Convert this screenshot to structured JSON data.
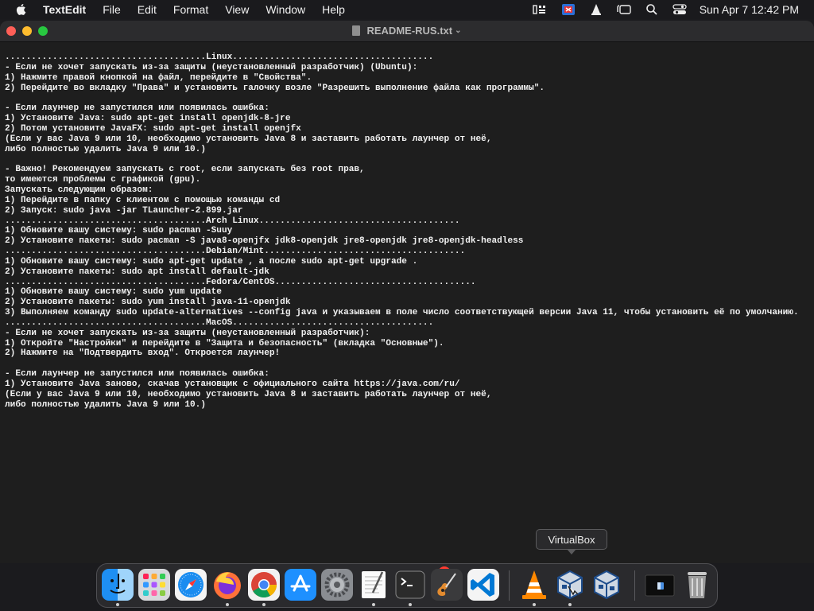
{
  "menubar": {
    "app_name": "TextEdit",
    "items": [
      "File",
      "Edit",
      "Format",
      "View",
      "Window",
      "Help"
    ],
    "clock": "Sun Apr 7  12:42 PM",
    "status_icons": [
      "keyboard-viewer-icon",
      "screen-share-icon",
      "vlc-icon",
      "window-icon",
      "search-icon",
      "control-center-icon"
    ]
  },
  "window": {
    "title": "README-RUS.txt",
    "lines": [
      "......................................Linux......................................",
      "- Если не хочет запускать из-за защиты (неустановленный разработчик) (Ubuntu):",
      "1) Нажмите правой кнопкой на файл, перейдите в \"Свойства\".",
      "2) Перейдите во вкладку \"Права\" и установить галочку возле \"Разрешить выполнение файла как программы\".",
      "",
      "- Если лаунчер не запустился или появилась ошибка:",
      "1) Установите Java: sudo apt-get install openjdk-8-jre",
      "2) Потом установите JavaFX: sudo apt-get install openjfx",
      "(Если у вас Java 9 или 10, необходимо установить Java 8 и заставить работать лаунчер от неё,",
      "либо полностью удалить Java 9 или 10.)",
      "",
      "- Важно! Рекомендуем запускать с root, если запускать без root прав,",
      "то имеются проблемы с графикой (gpu).",
      "Запускать следующим образом:",
      "1) Перейдите в папку с клиентом с помощью команды cd",
      "2) Запуск: sudo java -jar TLauncher-2.899.jar",
      "......................................Arch Linux......................................",
      "1) Обновите вашу систему: sudo pacman -Suuy",
      "2) Установите пакеты: sudo pacman -S java8-openjfx jdk8-openjdk jre8-openjdk jre8-openjdk-headless",
      "......................................Debian/Mint......................................",
      "1) Обновите вашу систему: sudo apt-get update , а после sudo apt-get upgrade .",
      "2) Установите пакеты: sudo apt install default-jdk",
      "......................................Fedora/CentOS......................................",
      "1) Обновите вашу систему: sudo yum update",
      "2) Установите пакеты: sudo yum install java-11-openjdk",
      "3) Выполняем команду sudo update-alternatives --config java и указываем в поле число соответствующей версии Java 11, чтобы установить её по умолчанию.",
      "......................................MacOS......................................",
      "- Если не хочет запускать из-за защиты (неустановленный разработчик):",
      "1) Откройте \"Настройки\" и перейдите в \"Защита и безопасность\" (вкладка \"Основные\").",
      "2) Нажмите на \"Подтвердить вход\". Откроется лаунчер!",
      "",
      "- Если лаунчер не запустился или появилась ошибка:",
      "1) Установите Java заново, скачав установщик с официального сайта https://java.com/ru/",
      "(Если у вас Java 9 или 10, необходимо установить Java 8 и заставить работать лаунчер от неё,",
      "либо полностью удалить Java 9 или 10.)"
    ]
  },
  "tooltip": "VirtualBox",
  "dock": {
    "apps": [
      "finder-icon",
      "launchpad-icon",
      "safari-icon",
      "firefox-icon",
      "chrome-icon",
      "app-store-icon",
      "system-settings-icon",
      "textedit-icon",
      "terminal-icon",
      "garageband-icon",
      "vscode-icon",
      "vlc-icon",
      "virtualbox-icon",
      "virtualbox-icon",
      "screen-icon",
      "trash-icon"
    ],
    "settings_badge": "1",
    "colors": {
      "finder": "#1e8ff3",
      "firefox": "#ff7139",
      "vscode": "#0078d4",
      "vlc": "#ff8800"
    }
  }
}
